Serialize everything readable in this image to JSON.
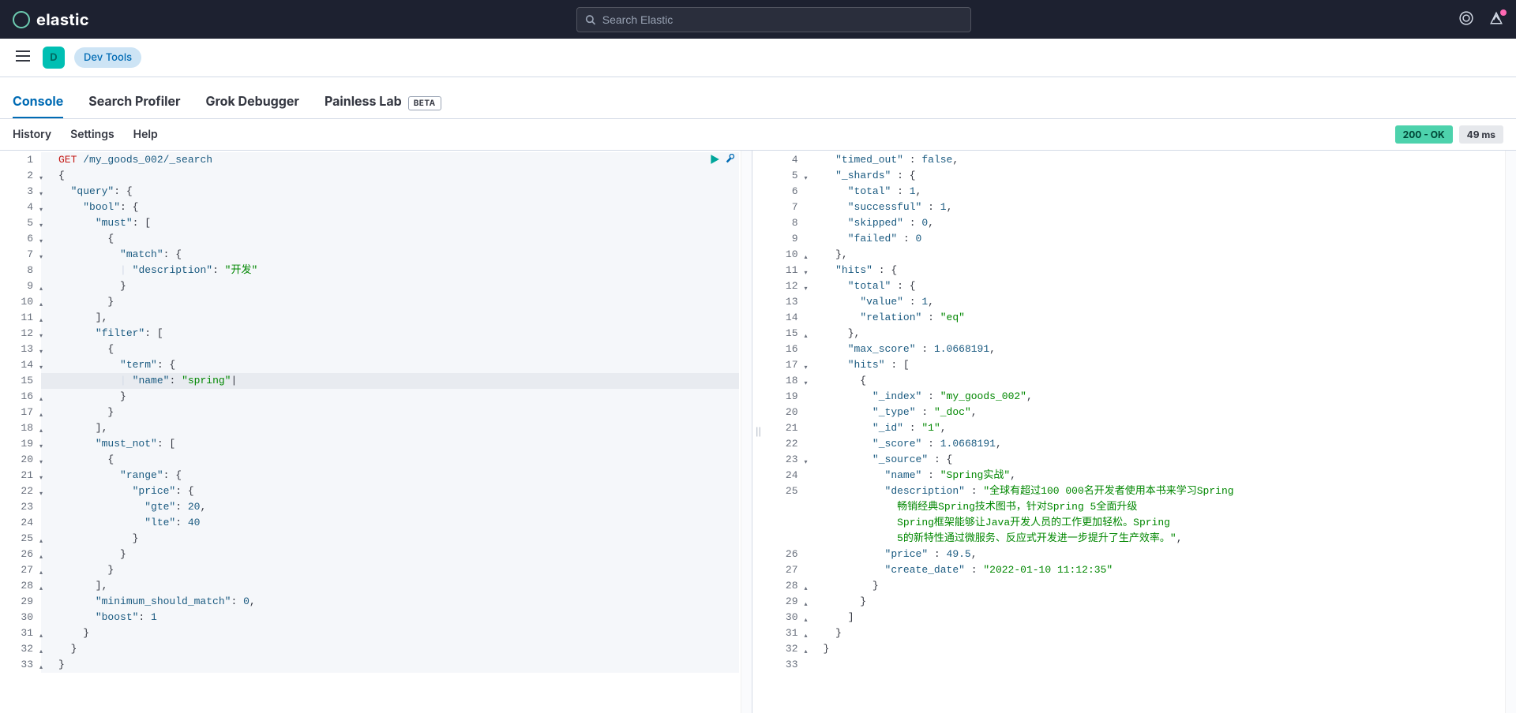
{
  "header": {
    "brand": "elastic",
    "search_placeholder": "Search Elastic"
  },
  "subheader": {
    "space_letter": "D",
    "breadcrumb": "Dev Tools"
  },
  "tabs": [
    {
      "label": "Console",
      "active": true,
      "badge": ""
    },
    {
      "label": "Search Profiler",
      "active": false,
      "badge": ""
    },
    {
      "label": "Grok Debugger",
      "active": false,
      "badge": ""
    },
    {
      "label": "Painless Lab",
      "active": false,
      "badge": "BETA"
    }
  ],
  "toolbar": {
    "links": [
      "History",
      "Settings",
      "Help"
    ],
    "status_ok": "200 - OK",
    "status_time": "49 ms"
  },
  "request": {
    "method": "GET",
    "path": "/my_goods_002/_search",
    "body": {
      "query": {
        "bool": {
          "must": [
            {
              "match": {
                "description": "开发"
              }
            }
          ],
          "filter": [
            {
              "term": {
                "name": "spring"
              }
            }
          ],
          "must_not": [
            {
              "range": {
                "price": {
                  "gte": 20,
                  "lte": 40
                }
              }
            }
          ],
          "minimum_should_match": 0,
          "boost": 1
        }
      }
    }
  },
  "request_lines": [
    {
      "n": 1
    },
    {
      "n": 2,
      "fold": "▾"
    },
    {
      "n": 3,
      "fold": "▾"
    },
    {
      "n": 4,
      "fold": "▾"
    },
    {
      "n": 5,
      "fold": "▾"
    },
    {
      "n": 6,
      "fold": "▾"
    },
    {
      "n": 7,
      "fold": "▾"
    },
    {
      "n": 8
    },
    {
      "n": 9,
      "fold": "▴"
    },
    {
      "n": 10,
      "fold": "▴"
    },
    {
      "n": 11,
      "fold": "▴"
    },
    {
      "n": 12,
      "fold": "▾"
    },
    {
      "n": 13,
      "fold": "▾"
    },
    {
      "n": 14,
      "fold": "▾"
    },
    {
      "n": 15
    },
    {
      "n": 16,
      "fold": "▴"
    },
    {
      "n": 17,
      "fold": "▴"
    },
    {
      "n": 18,
      "fold": "▴"
    },
    {
      "n": 19,
      "fold": "▾"
    },
    {
      "n": 20,
      "fold": "▾"
    },
    {
      "n": 21,
      "fold": "▾"
    },
    {
      "n": 22,
      "fold": "▾"
    },
    {
      "n": 23
    },
    {
      "n": 24
    },
    {
      "n": 25,
      "fold": "▴"
    },
    {
      "n": 26,
      "fold": "▴"
    },
    {
      "n": 27,
      "fold": "▴"
    },
    {
      "n": 28,
      "fold": "▴"
    },
    {
      "n": 29
    },
    {
      "n": 30
    },
    {
      "n": 31,
      "fold": "▴"
    },
    {
      "n": 32,
      "fold": "▴"
    },
    {
      "n": 33,
      "fold": "▴"
    }
  ],
  "response": {
    "timed_out": false,
    "_shards": {
      "total": 1,
      "successful": 1,
      "skipped": 0,
      "failed": 0
    },
    "hits": {
      "total": {
        "value": 1,
        "relation": "eq"
      },
      "max_score": 1.0668191,
      "hits": [
        {
          "_index": "my_goods_002",
          "_type": "_doc",
          "_id": "1",
          "_score": 1.0668191,
          "_source": {
            "name": "Spring实战",
            "description": "全球有超过100 000名开发者使用本书来学习Spring畅销经典Spring技术图书，针对Spring 5全面升级 Spring框架能够让Java开发人员的工作更加轻松。Spring 5的新特性通过微服务、反应式开发进一步提升了生产效率。",
            "price": 49.5,
            "create_date": "2022-01-10 11:12:35"
          }
        }
      ]
    }
  },
  "response_lines": [
    {
      "n": 4
    },
    {
      "n": 5,
      "fold": "▾"
    },
    {
      "n": 6
    },
    {
      "n": 7
    },
    {
      "n": 8
    },
    {
      "n": 9
    },
    {
      "n": 10,
      "fold": "▴"
    },
    {
      "n": 11,
      "fold": "▾"
    },
    {
      "n": 12,
      "fold": "▾"
    },
    {
      "n": 13
    },
    {
      "n": 14
    },
    {
      "n": 15,
      "fold": "▴"
    },
    {
      "n": 16
    },
    {
      "n": 17,
      "fold": "▾"
    },
    {
      "n": 18,
      "fold": "▾"
    },
    {
      "n": 19
    },
    {
      "n": 20
    },
    {
      "n": 21
    },
    {
      "n": 22
    },
    {
      "n": 23,
      "fold": "▾"
    },
    {
      "n": 24
    },
    {
      "n": 25
    },
    {
      "n": ""
    },
    {
      "n": ""
    },
    {
      "n": ""
    },
    {
      "n": 26
    },
    {
      "n": 27
    },
    {
      "n": 28,
      "fold": "▴"
    },
    {
      "n": 29,
      "fold": "▴"
    },
    {
      "n": 30,
      "fold": "▴"
    },
    {
      "n": 31,
      "fold": "▴"
    },
    {
      "n": 32,
      "fold": "▴"
    },
    {
      "n": 33
    }
  ]
}
